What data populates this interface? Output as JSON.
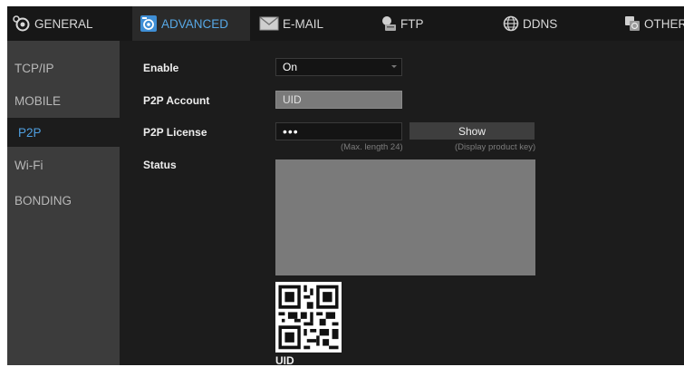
{
  "tabs": [
    {
      "label": "GENERAL",
      "icon": "gear-icon"
    },
    {
      "label": "ADVANCED",
      "icon": "camera-settings-icon"
    },
    {
      "label": "E-MAIL",
      "icon": "envelope-icon"
    },
    {
      "label": "FTP",
      "icon": "ftp-icon"
    },
    {
      "label": "DDNS",
      "icon": "globe-icon"
    },
    {
      "label": "OTHER",
      "icon": "others-icon"
    }
  ],
  "active_tab": "ADVANCED",
  "sidebar": {
    "items": [
      {
        "label": "TCP/IP"
      },
      {
        "label": "MOBILE"
      },
      {
        "label": "P2P"
      },
      {
        "label": "Wi-Fi"
      },
      {
        "label": "BONDING"
      }
    ],
    "active": "P2P"
  },
  "form": {
    "enable": {
      "label": "Enable",
      "value": "On"
    },
    "account": {
      "label": "P2P Account",
      "value": "UID"
    },
    "license": {
      "label": "P2P License",
      "value": "•••",
      "hint": "(Max. length 24)"
    },
    "show_button": {
      "label": "Show",
      "hint": "(Display product key)"
    },
    "status": {
      "label": "Status"
    }
  },
  "qr": {
    "caption": "UID"
  },
  "colors": {
    "accent": "#4f9fe0",
    "background": "#1c1c1c",
    "sidebar": "#3c3c3c",
    "readonly_field": "#7a7a7a"
  }
}
